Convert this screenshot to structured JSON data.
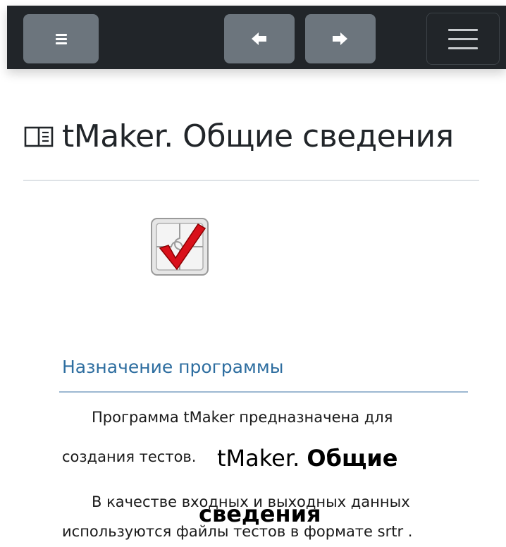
{
  "toolbar": {
    "menu_button": "menu-icon",
    "prev_button": "arrow-left-icon",
    "next_button": "arrow-right-icon",
    "toggle_button": "hamburger-icon",
    "background": "#212529",
    "button_color": "#6c757d"
  },
  "page": {
    "title": "tMaker. Общие сведения",
    "title_icon": "book-open-icon"
  },
  "document": {
    "heading_part1": "tMaker. ",
    "heading_part2": "Общие",
    "heading_part3": "сведения",
    "app_icon": "puzzle-checkmark-icon",
    "section_title": "Назначение программы",
    "section_color": "#2e6ea0",
    "paragraph1_line1": "Программа tMaker предназначена для",
    "paragraph1_line2": "создания тестов.",
    "paragraph2_line1": "В качестве входных и выходных данных",
    "paragraph2_line2": "используются файлы тестов в формате srtr ."
  }
}
